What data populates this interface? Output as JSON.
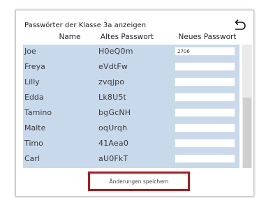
{
  "dialog": {
    "title": "Passwörter der Klasse 3a anzeigen",
    "back_icon": "undo-arrow-icon"
  },
  "columns": {
    "name": "Name",
    "old_password": "Altes Passwort",
    "new_password": "Neues Passwort"
  },
  "rows": [
    {
      "name": "Joe",
      "old_password": "H0eQ0m",
      "new_password": "2706"
    },
    {
      "name": "Freya",
      "old_password": "eVdtFw",
      "new_password": ""
    },
    {
      "name": "Lilly",
      "old_password": "zvqjpo",
      "new_password": ""
    },
    {
      "name": "Edda",
      "old_password": "Lk8U5t",
      "new_password": ""
    },
    {
      "name": "Tamino",
      "old_password": "bgGcNH",
      "new_password": ""
    },
    {
      "name": "Malte",
      "old_password": "oqUrqh",
      "new_password": ""
    },
    {
      "name": "Timo",
      "old_password": "41Aea0",
      "new_password": ""
    },
    {
      "name": "Carl",
      "old_password": "aU0FkT",
      "new_password": ""
    }
  ],
  "footer": {
    "save_label": "Änderungen speichern"
  }
}
